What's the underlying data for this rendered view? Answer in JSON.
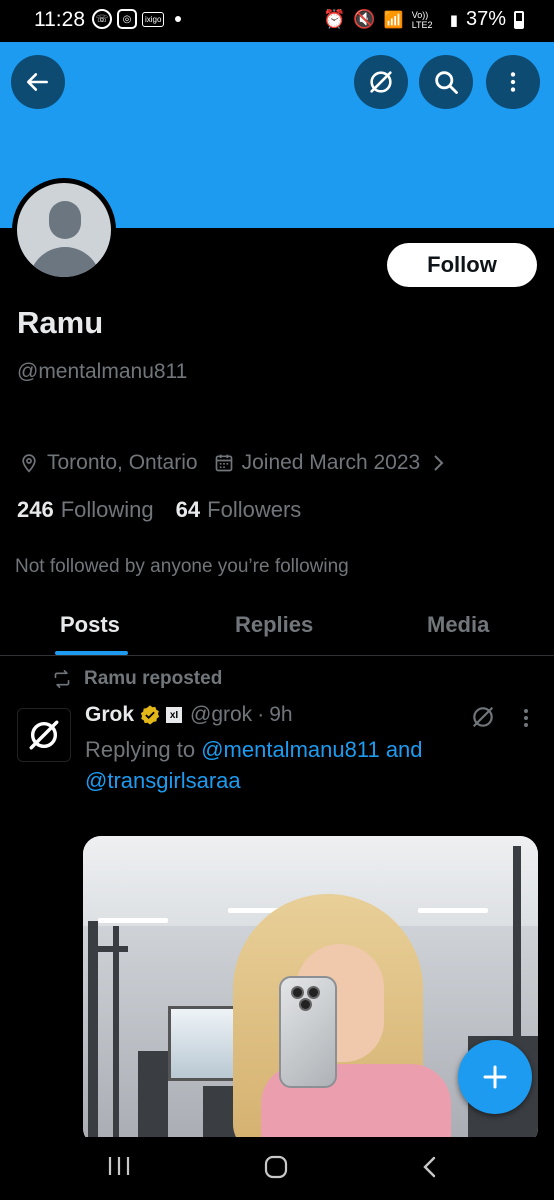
{
  "status_bar": {
    "time": "11:28",
    "ixigo_label": "ixigo",
    "network_label": "Vo)) LTE2",
    "battery": "37%"
  },
  "header": {
    "back_icon": "arrow-left-icon",
    "grok_icon": "grok-icon",
    "search_icon": "search-icon",
    "more_icon": "more-vertical-icon",
    "banner_color": "#1d9bf0"
  },
  "profile": {
    "follow_label": "Follow",
    "name": "Ramu",
    "handle": "@mentalmanu811",
    "location": "Toronto, Ontario",
    "joined": "Joined March 2023",
    "following_count": "246",
    "following_label": "Following",
    "followers_count": "64",
    "followers_label": "Followers",
    "not_followed_text": "Not followed by anyone you’re following"
  },
  "tabs": [
    {
      "label": "Posts",
      "active": true
    },
    {
      "label": "Replies",
      "active": false
    },
    {
      "label": "Media",
      "active": false
    }
  ],
  "post": {
    "repost_text": "Ramu reposted",
    "author": "Grok",
    "author_badge": "xI",
    "author_handle": "@grok",
    "separator": "·",
    "time": "9h",
    "replying_prefix": "Replying to",
    "mention_1": "@mentalmanu811",
    "and_text": "and",
    "mention_2": "@transgirlsaraa"
  },
  "colors": {
    "accent": "#1d9bf0",
    "verified_gold": "#e2b719",
    "muted_text": "#71767b"
  }
}
